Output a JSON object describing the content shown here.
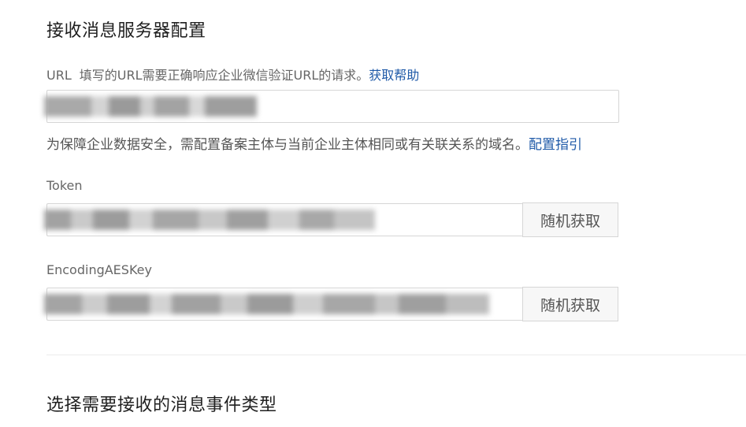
{
  "server_config": {
    "title": "接收消息服务器配置",
    "url": {
      "label": "URL",
      "hint": "填写的URL需要正确响应企业微信验证URL的请求。",
      "help_link": "获取帮助",
      "note": "为保障企业数据安全，需配置备案主体与当前企业主体相同或有关联关系的域名。",
      "guide_link": "配置指引"
    },
    "token": {
      "label": "Token",
      "random_button": "随机获取"
    },
    "aes_key": {
      "label": "EncodingAESKey",
      "random_button": "随机获取"
    }
  },
  "event_types": {
    "title": "选择需要接收的消息事件类型"
  },
  "colors": {
    "link": "#1f5aa8",
    "label": "#666666",
    "border": "#d6d6d6"
  }
}
